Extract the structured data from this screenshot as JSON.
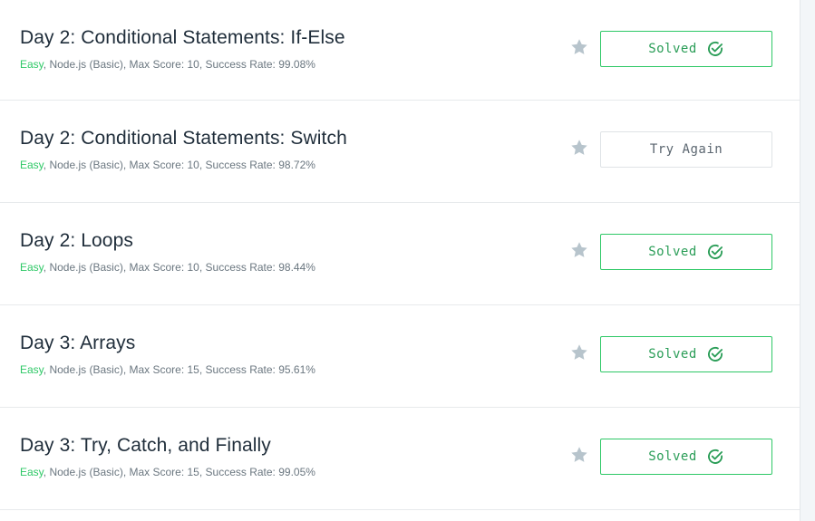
{
  "challenges": [
    {
      "title": "Day 2: Conditional Statements: If-Else",
      "difficulty": "Easy",
      "details": ", Node.js (Basic), Max Score: 10, Success Rate: 99.08%",
      "status": "Solved",
      "solved": true
    },
    {
      "title": "Day 2: Conditional Statements: Switch",
      "difficulty": "Easy",
      "details": ", Node.js (Basic), Max Score: 10, Success Rate: 98.72%",
      "status": "Try Again",
      "solved": false
    },
    {
      "title": "Day 2: Loops",
      "difficulty": "Easy",
      "details": ", Node.js (Basic), Max Score: 10, Success Rate: 98.44%",
      "status": "Solved",
      "solved": true
    },
    {
      "title": "Day 3: Arrays",
      "difficulty": "Easy",
      "details": ", Node.js (Basic), Max Score: 15, Success Rate: 95.61%",
      "status": "Solved",
      "solved": true
    },
    {
      "title": "Day 3: Try, Catch, and Finally",
      "difficulty": "Easy",
      "details": ", Node.js (Basic), Max Score: 15, Success Rate: 99.05%",
      "status": "Solved",
      "solved": true
    }
  ],
  "colors": {
    "accent_green": "#2ec866",
    "star_gray": "#b7c4cc"
  },
  "icons": {
    "star": "star-icon",
    "check": "check-circle-icon"
  }
}
